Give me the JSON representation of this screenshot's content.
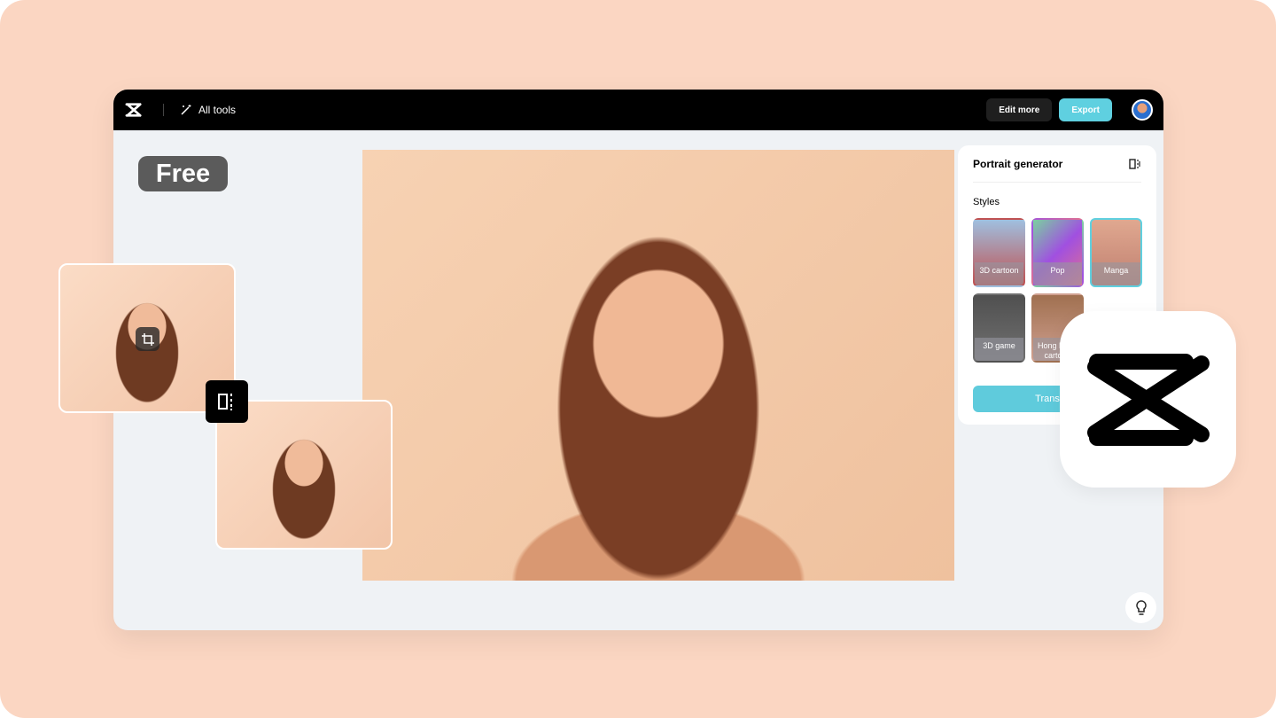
{
  "header": {
    "all_tools": "All tools",
    "edit_more": "Edit more",
    "export": "Export"
  },
  "badge": "Free",
  "panel": {
    "title": "Portrait generator",
    "styles_label": "Styles",
    "styles": [
      {
        "label": "3D cartoon",
        "bg": "linear-gradient(#9fc0e0,#c05050)"
      },
      {
        "label": "Pop",
        "bg": "linear-gradient(135deg,#7ad0a0,#a050e0,#e07090)"
      },
      {
        "label": "Manga",
        "bg": "linear-gradient(#e0a890,#c08070)"
      },
      {
        "label": "3D game",
        "bg": "linear-gradient(#505050,#707070)"
      },
      {
        "label": "Hong Kong cartoon",
        "bg": "linear-gradient(#a07050,#d0a090)"
      }
    ],
    "transform": "Transform"
  },
  "colors": {
    "accent": "#5fd0e0",
    "background": "#fbd6c2"
  }
}
